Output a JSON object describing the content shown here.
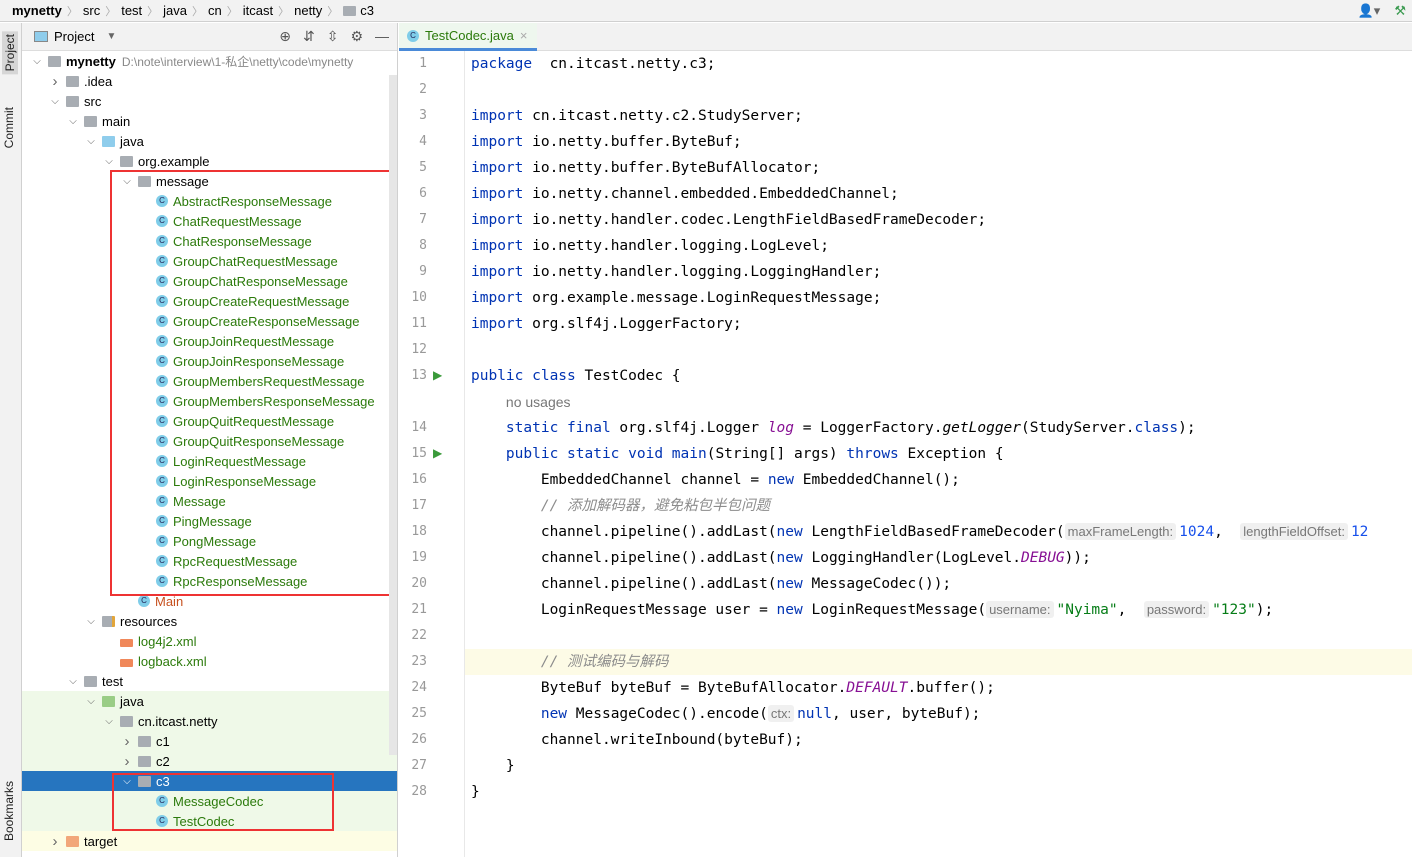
{
  "breadcrumb": [
    "mynetty",
    "src",
    "test",
    "java",
    "cn",
    "itcast",
    "netty",
    "c3"
  ],
  "toolstrip": {
    "project": "Project",
    "commit": "Commit",
    "bookmarks": "Bookmarks"
  },
  "project_panel": {
    "title": "Project",
    "icons": [
      "locate-icon",
      "expand-all-icon",
      "collapse-all-icon",
      "gear-icon",
      "minimize-icon"
    ]
  },
  "tree": [
    {
      "label": "mynetty",
      "path": "D:\\note\\interview\\1-私企\\netty\\code\\mynetty",
      "level": 0,
      "icon": "module",
      "arrow": "down",
      "bold": true
    },
    {
      "label": ".idea",
      "level": 1,
      "icon": "folder",
      "arrow": "right"
    },
    {
      "label": "src",
      "level": 1,
      "icon": "folder",
      "arrow": "down"
    },
    {
      "label": "main",
      "level": 2,
      "icon": "folder",
      "arrow": "down"
    },
    {
      "label": "java",
      "level": 3,
      "icon": "src",
      "arrow": "down"
    },
    {
      "label": "org.example",
      "level": 4,
      "icon": "folder",
      "arrow": "down"
    },
    {
      "label": "message",
      "level": 5,
      "icon": "folder",
      "arrow": "down"
    },
    {
      "label": "AbstractResponseMessage",
      "level": 6,
      "icon": "cls",
      "color": "green"
    },
    {
      "label": "ChatRequestMessage",
      "level": 6,
      "icon": "cls",
      "color": "green"
    },
    {
      "label": "ChatResponseMessage",
      "level": 6,
      "icon": "cls",
      "color": "green"
    },
    {
      "label": "GroupChatRequestMessage",
      "level": 6,
      "icon": "cls",
      "color": "green"
    },
    {
      "label": "GroupChatResponseMessage",
      "level": 6,
      "icon": "cls",
      "color": "green"
    },
    {
      "label": "GroupCreateRequestMessage",
      "level": 6,
      "icon": "cls",
      "color": "green"
    },
    {
      "label": "GroupCreateResponseMessage",
      "level": 6,
      "icon": "cls",
      "color": "green"
    },
    {
      "label": "GroupJoinRequestMessage",
      "level": 6,
      "icon": "cls",
      "color": "green"
    },
    {
      "label": "GroupJoinResponseMessage",
      "level": 6,
      "icon": "cls",
      "color": "green"
    },
    {
      "label": "GroupMembersRequestMessage",
      "level": 6,
      "icon": "cls",
      "color": "green"
    },
    {
      "label": "GroupMembersResponseMessage",
      "level": 6,
      "icon": "cls",
      "color": "green"
    },
    {
      "label": "GroupQuitRequestMessage",
      "level": 6,
      "icon": "cls",
      "color": "green"
    },
    {
      "label": "GroupQuitResponseMessage",
      "level": 6,
      "icon": "cls",
      "color": "green"
    },
    {
      "label": "LoginRequestMessage",
      "level": 6,
      "icon": "cls",
      "color": "green"
    },
    {
      "label": "LoginResponseMessage",
      "level": 6,
      "icon": "cls",
      "color": "green"
    },
    {
      "label": "Message",
      "level": 6,
      "icon": "cls",
      "color": "green"
    },
    {
      "label": "PingMessage",
      "level": 6,
      "icon": "cls",
      "color": "green"
    },
    {
      "label": "PongMessage",
      "level": 6,
      "icon": "cls",
      "color": "green"
    },
    {
      "label": "RpcRequestMessage",
      "level": 6,
      "icon": "cls",
      "color": "green"
    },
    {
      "label": "RpcResponseMessage",
      "level": 6,
      "icon": "cls",
      "color": "green"
    },
    {
      "label": "Main",
      "level": 5,
      "icon": "cls",
      "color": "orange"
    },
    {
      "label": "resources",
      "level": 3,
      "icon": "res",
      "arrow": "down"
    },
    {
      "label": "log4j2.xml",
      "level": 4,
      "icon": "xml",
      "color": "green"
    },
    {
      "label": "logback.xml",
      "level": 4,
      "icon": "xml",
      "color": "green"
    },
    {
      "label": "test",
      "level": 2,
      "icon": "folder",
      "arrow": "down"
    },
    {
      "label": "java",
      "level": 3,
      "icon": "test",
      "arrow": "down",
      "bg": "test"
    },
    {
      "label": "cn.itcast.netty",
      "level": 4,
      "icon": "folder",
      "arrow": "down",
      "bg": "test"
    },
    {
      "label": "c1",
      "level": 5,
      "icon": "folder",
      "arrow": "right",
      "bg": "test"
    },
    {
      "label": "c2",
      "level": 5,
      "icon": "folder",
      "arrow": "right",
      "bg": "test"
    },
    {
      "label": "c3",
      "level": 5,
      "icon": "folder",
      "arrow": "down",
      "bg": "selected"
    },
    {
      "label": "MessageCodec",
      "level": 6,
      "icon": "cls",
      "color": "green",
      "bg": "test"
    },
    {
      "label": "TestCodec",
      "level": 6,
      "icon": "cls",
      "color": "green",
      "bg": "test"
    },
    {
      "label": "target",
      "level": 1,
      "icon": "target",
      "arrow": "right",
      "bg": "target"
    }
  ],
  "editor": {
    "tab": "TestCodec.java",
    "highlight_line": 23,
    "lines": [
      {
        "n": "1",
        "t": [
          [
            "kw",
            "package"
          ],
          [
            "",
            "  cn.itcast.netty.c3;"
          ]
        ]
      },
      {
        "n": "2",
        "t": []
      },
      {
        "n": "3",
        "t": [
          [
            "kw",
            "import"
          ],
          [
            "",
            " cn.itcast.netty.c2.StudyServer;"
          ]
        ]
      },
      {
        "n": "4",
        "t": [
          [
            "kw",
            "import"
          ],
          [
            "",
            " io.netty.buffer.ByteBuf;"
          ]
        ]
      },
      {
        "n": "5",
        "t": [
          [
            "kw",
            "import"
          ],
          [
            "",
            " io.netty.buffer.ByteBufAllocator;"
          ]
        ]
      },
      {
        "n": "6",
        "t": [
          [
            "kw",
            "import"
          ],
          [
            "",
            " io.netty.channel.embedded.EmbeddedChannel;"
          ]
        ]
      },
      {
        "n": "7",
        "t": [
          [
            "kw",
            "import"
          ],
          [
            "",
            " io.netty.handler.codec.LengthFieldBasedFrameDecoder;"
          ]
        ]
      },
      {
        "n": "8",
        "t": [
          [
            "kw",
            "import"
          ],
          [
            "",
            " io.netty.handler.logging.LogLevel;"
          ]
        ]
      },
      {
        "n": "9",
        "t": [
          [
            "kw",
            "import"
          ],
          [
            "",
            " io.netty.handler.logging.LoggingHandler;"
          ]
        ]
      },
      {
        "n": "10",
        "t": [
          [
            "kw",
            "import"
          ],
          [
            "",
            " org.example.message.LoginRequestMessage;"
          ]
        ]
      },
      {
        "n": "11",
        "t": [
          [
            "kw",
            "import"
          ],
          [
            "",
            " org.slf4j.LoggerFactory;"
          ]
        ]
      },
      {
        "n": "12",
        "t": []
      },
      {
        "n": "13",
        "run": true,
        "t": [
          [
            "kw",
            "public class"
          ],
          [
            "",
            " TestCodec {"
          ]
        ]
      },
      {
        "n": "",
        "t": [
          [
            "",
            "    "
          ],
          [
            "usg",
            "no usages"
          ]
        ]
      },
      {
        "n": "14",
        "t": [
          [
            "",
            "    "
          ],
          [
            "kw",
            "static final"
          ],
          [
            "",
            " org.slf4j.Logger "
          ],
          [
            "fld",
            "log"
          ],
          [
            "",
            " = LoggerFactory."
          ],
          [
            "it",
            "getLogger"
          ],
          [
            "",
            "(StudyServer."
          ],
          [
            "kw",
            "class"
          ],
          [
            "",
            ");"
          ]
        ]
      },
      {
        "n": "15",
        "run": true,
        "t": [
          [
            "",
            "    "
          ],
          [
            "kw",
            "public static void"
          ],
          [
            "",
            " "
          ],
          [
            "kw",
            "main"
          ],
          [
            "",
            "(String[] args) "
          ],
          [
            "kw",
            "throws"
          ],
          [
            "",
            " Exception {"
          ]
        ]
      },
      {
        "n": "16",
        "t": [
          [
            "",
            "        EmbeddedChannel channel = "
          ],
          [
            "kw",
            "new"
          ],
          [
            "",
            " EmbeddedChannel();"
          ]
        ]
      },
      {
        "n": "17",
        "t": [
          [
            "",
            "        "
          ],
          [
            "cm",
            "// 添加解码器，避免粘包半包问题"
          ]
        ]
      },
      {
        "n": "18",
        "t": [
          [
            "",
            "        channel.pipeline().addLast("
          ],
          [
            "kw",
            "new"
          ],
          [
            "",
            " LengthFieldBasedFrameDecoder("
          ],
          [
            "hint",
            "maxFrameLength:"
          ],
          [
            "num",
            "1024"
          ],
          [
            "",
            ",  "
          ],
          [
            "hint",
            "lengthFieldOffset:"
          ],
          [
            "num",
            "12"
          ]
        ]
      },
      {
        "n": "19",
        "t": [
          [
            "",
            "        channel.pipeline().addLast("
          ],
          [
            "kw",
            "new"
          ],
          [
            "",
            " LoggingHandler(LogLevel."
          ],
          [
            "st",
            "DEBUG"
          ],
          [
            "",
            "));"
          ]
        ]
      },
      {
        "n": "20",
        "t": [
          [
            "",
            "        channel.pipeline().addLast("
          ],
          [
            "kw",
            "new"
          ],
          [
            "",
            " MessageCodec());"
          ]
        ]
      },
      {
        "n": "21",
        "t": [
          [
            "",
            "        LoginRequestMessage user = "
          ],
          [
            "kw",
            "new"
          ],
          [
            "",
            " LoginRequestMessage("
          ],
          [
            "hint",
            "username:"
          ],
          [
            "str",
            "\"Nyima\""
          ],
          [
            "",
            ",  "
          ],
          [
            "hint",
            "password:"
          ],
          [
            "str",
            "\"123\""
          ],
          [
            "",
            ");"
          ]
        ]
      },
      {
        "n": "22",
        "t": []
      },
      {
        "n": "23",
        "bulb": true,
        "t": [
          [
            "",
            "        "
          ],
          [
            "cm",
            "// 测试编码与解码"
          ]
        ]
      },
      {
        "n": "24",
        "t": [
          [
            "",
            "        ByteBuf byteBuf = ByteBufAllocator."
          ],
          [
            "st",
            "DEFAULT"
          ],
          [
            "",
            ".buffer();"
          ]
        ]
      },
      {
        "n": "25",
        "t": [
          [
            "",
            "        "
          ],
          [
            "kw",
            "new"
          ],
          [
            "",
            " MessageCodec().encode("
          ],
          [
            "hint",
            "ctx:"
          ],
          [
            "kw",
            "null"
          ],
          [
            "",
            ", user, byteBuf);"
          ]
        ]
      },
      {
        "n": "26",
        "t": [
          [
            "",
            "        channel.writeInbound(byteBuf);"
          ]
        ]
      },
      {
        "n": "27",
        "t": [
          [
            "",
            "    }"
          ]
        ]
      },
      {
        "n": "28",
        "t": [
          [
            "",
            "}"
          ]
        ]
      }
    ]
  }
}
